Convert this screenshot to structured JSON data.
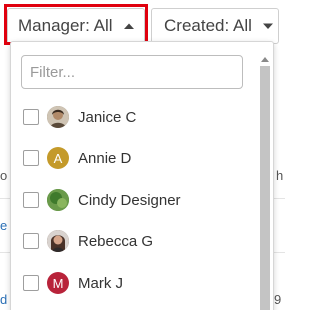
{
  "filters": {
    "manager": {
      "label": "Manager: All"
    },
    "created": {
      "label": "Created: All"
    }
  },
  "dropdown": {
    "filter_placeholder": "Filter...",
    "options": [
      {
        "label": "Janice C",
        "avatar": "photo",
        "avatar_color": "#7a6a55"
      },
      {
        "label": "Annie D",
        "avatar_letter": "A",
        "avatar_color": "#c49a2a"
      },
      {
        "label": "Cindy Designer",
        "avatar": "photo",
        "avatar_color": "#4f8a3a"
      },
      {
        "label": "Rebecca G",
        "avatar": "photo",
        "avatar_color": "#6a4d3e"
      },
      {
        "label": "Mark J",
        "avatar_letter": "M",
        "avatar_color": "#b8233a"
      }
    ]
  },
  "colors": {
    "highlight_border": "#e0000e",
    "scrollbar_thumb": "#c4c4c4"
  },
  "icons": {
    "manager_caret": "caret-up-icon",
    "created_caret": "caret-down-icon",
    "scroll_up": "scroll-up-arrow-icon"
  }
}
